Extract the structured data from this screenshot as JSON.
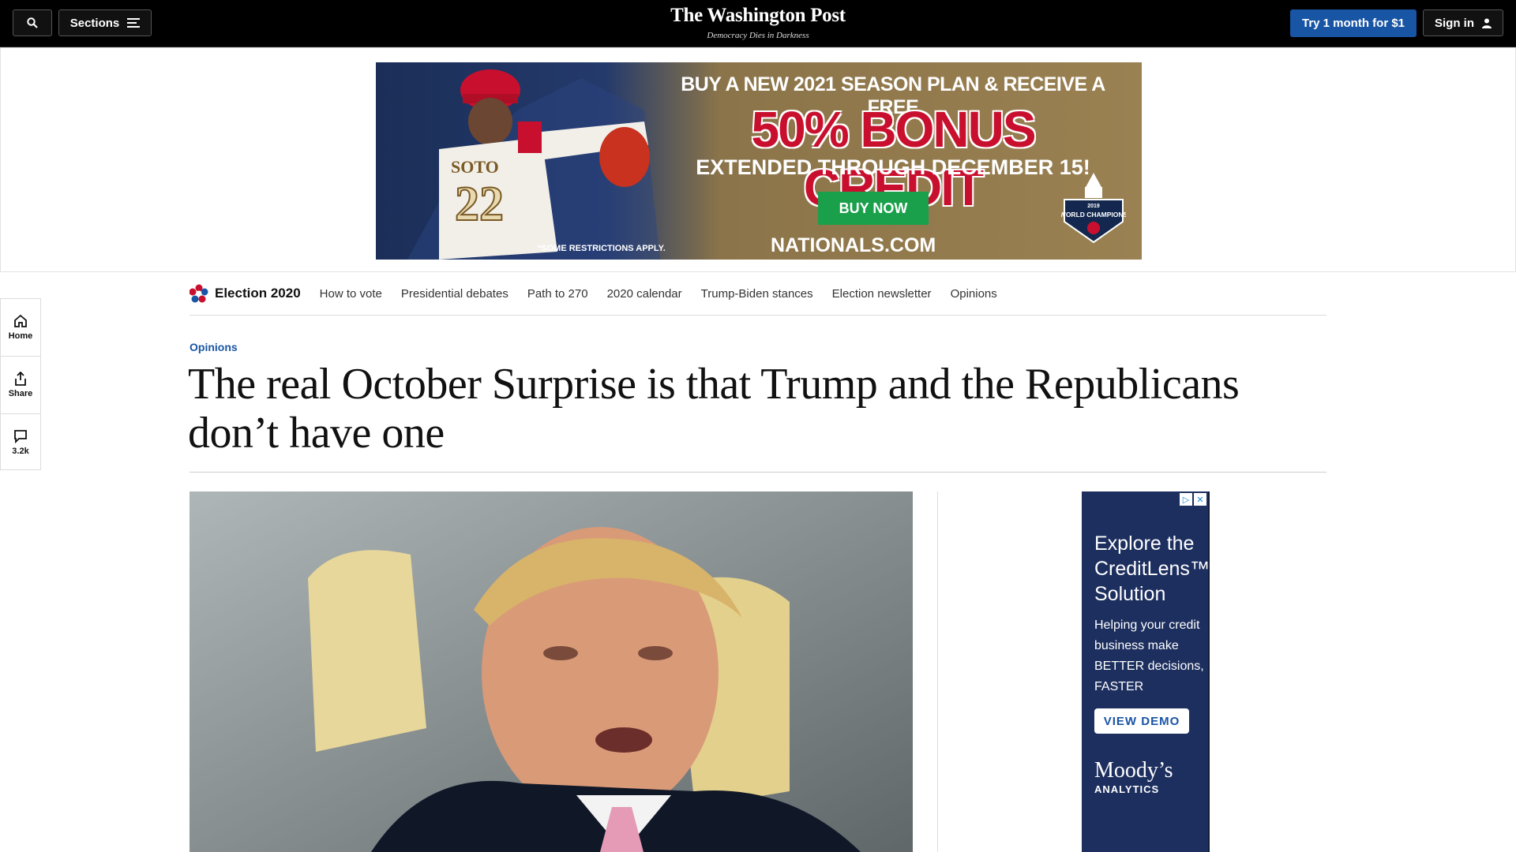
{
  "topbar": {
    "sections_label": "Sections",
    "logo": "The Washington Post",
    "tagline": "Democracy Dies in Darkness",
    "try_label": "Try 1 month for $1",
    "signin_label": "Sign in"
  },
  "ad_top": {
    "line1": "BUY A NEW 2021 SEASON PLAN & RECEIVE A FREE",
    "line2": "50% BONUS CREDIT",
    "line3": "EXTENDED THROUGH DECEMBER 15!",
    "button": "BUY NOW",
    "restrictions": "*SOME RESTRICTIONS APPLY.",
    "domain": "NATIONALS.COM",
    "badge_year": "2019",
    "badge_text": "WORLD CHAMPIONS",
    "jersey_name": "SOTO",
    "jersey_number": "22"
  },
  "rail": {
    "home": "Home",
    "share": "Share",
    "comments": "3.2k"
  },
  "election_nav": {
    "title": "Election 2020",
    "links": [
      "How to vote",
      "Presidential debates",
      "Path to 270",
      "2020 calendar",
      "Trump-Biden stances",
      "Election newsletter",
      "Opinions"
    ]
  },
  "article": {
    "kicker": "Opinions",
    "headline": "The real October Surprise is that Trump and the Republicans don’t have one"
  },
  "ad_side": {
    "headline": "Explore the CreditLens™ Solution",
    "subtext": "Helping your credit business make BETTER decisions, FASTER",
    "button": "VIEW DEMO",
    "brand": "Moody’s",
    "brand_sub": "ANALYTICS"
  },
  "colors": {
    "accent": "#1955a5",
    "topbar": "#000000",
    "ad_red": "#c8102e",
    "ad_green": "#1aa04b"
  }
}
